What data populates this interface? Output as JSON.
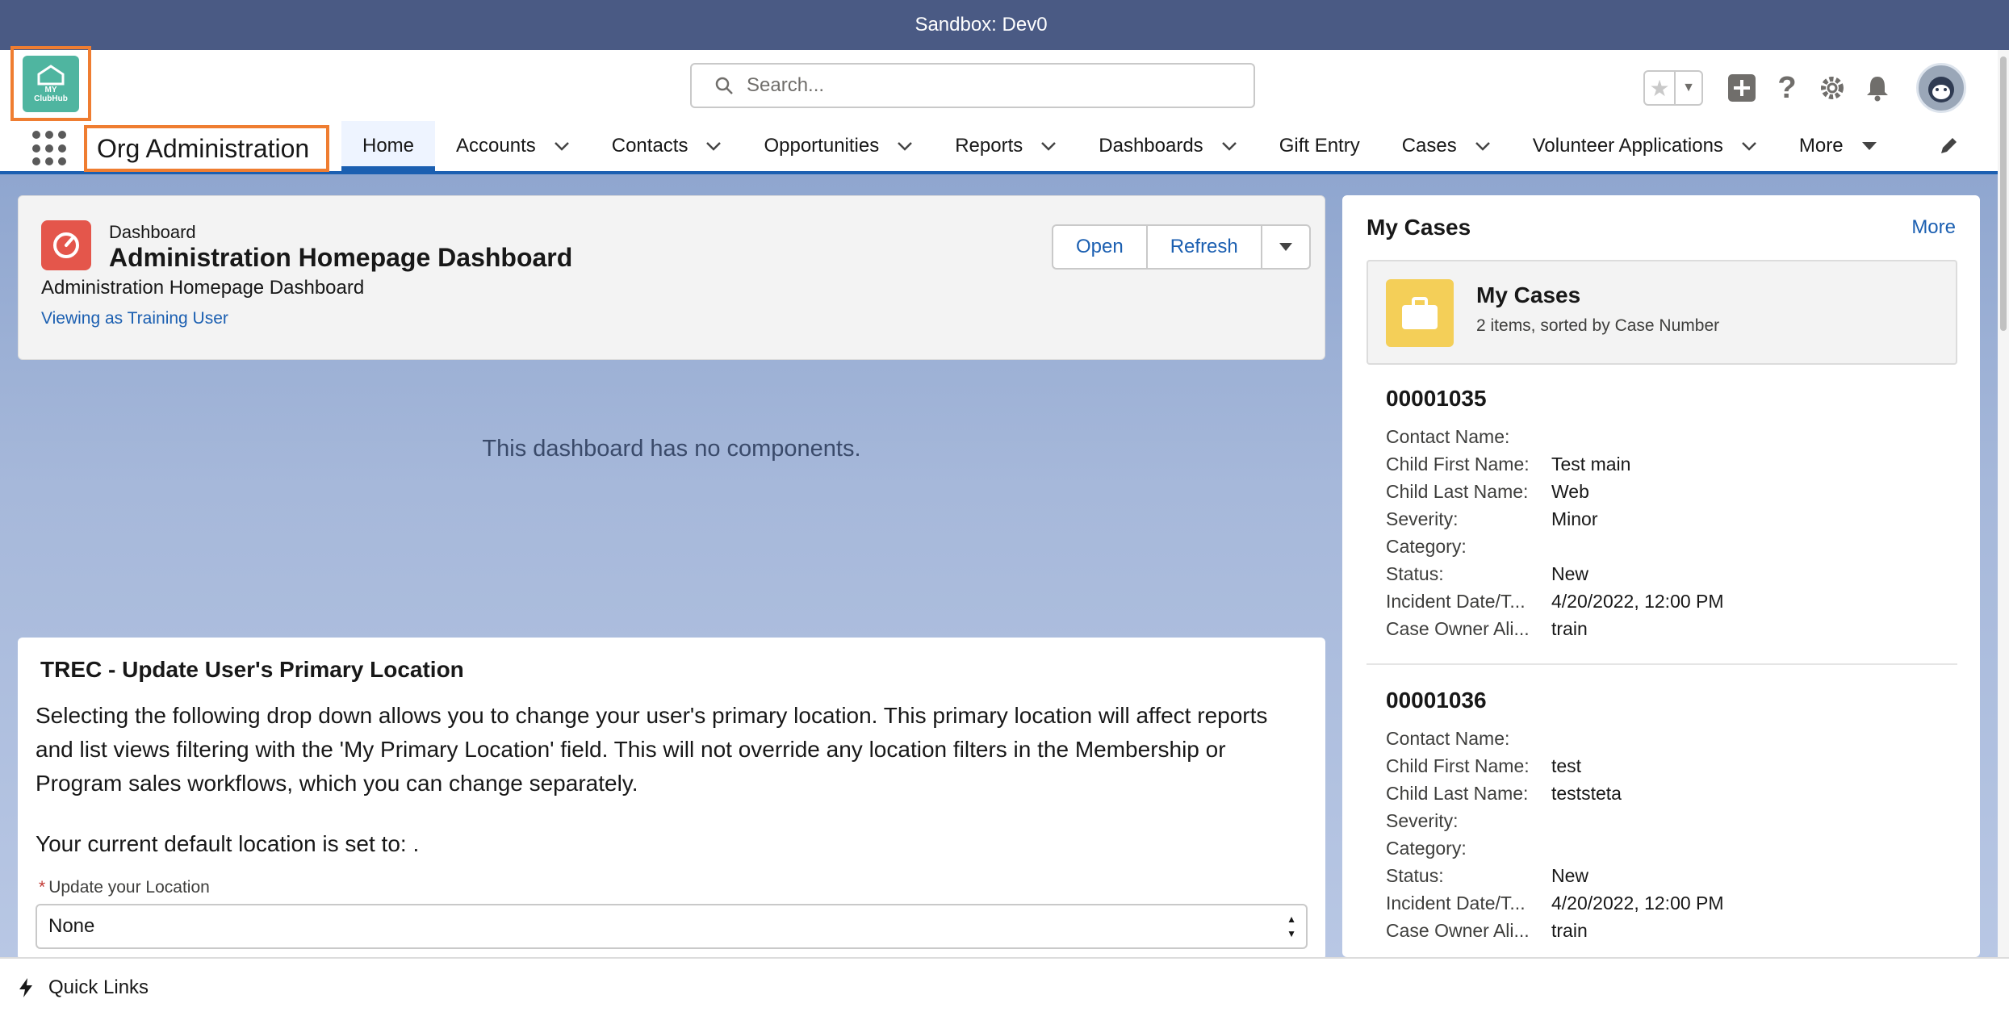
{
  "sandbox": {
    "label": "Sandbox: Dev0"
  },
  "logo": {
    "text_line1": "MY",
    "text_line2": "ClubHub"
  },
  "search": {
    "placeholder": "Search..."
  },
  "app": {
    "name": "Org Administration"
  },
  "nav": {
    "tabs": [
      {
        "label": "Home",
        "active": true,
        "has_menu": false
      },
      {
        "label": "Accounts",
        "has_menu": true
      },
      {
        "label": "Contacts",
        "has_menu": true
      },
      {
        "label": "Opportunities",
        "has_menu": true
      },
      {
        "label": "Reports",
        "has_menu": true
      },
      {
        "label": "Dashboards",
        "has_menu": true
      },
      {
        "label": "Gift Entry",
        "has_menu": false
      },
      {
        "label": "Cases",
        "has_menu": true
      },
      {
        "label": "Volunteer Applications",
        "has_menu": true
      },
      {
        "label": "More",
        "has_menu": true
      }
    ]
  },
  "dashboard": {
    "type_label": "Dashboard",
    "title": "Administration Homepage Dashboard",
    "subtitle": "Administration Homepage Dashboard",
    "viewing_as": "Viewing as Training User",
    "open_label": "Open",
    "refresh_label": "Refresh",
    "empty_message": "This dashboard has no components."
  },
  "trec": {
    "title": "TREC - Update User's Primary Location",
    "description": "Selecting the following drop down allows you to change your user's primary location. This primary location will affect reports and list views filtering with the 'My Primary Location' field. This will not override any location filters in the Membership or Program sales workflows, which you can change separately.",
    "current_location": "Your current default location is set to: .",
    "field_label": "Update your Location",
    "field_required_mark": "*",
    "selected_value": "None"
  },
  "my_cases": {
    "header": "My Cases",
    "more_label": "More",
    "list_title": "My Cases",
    "list_subtitle": "2 items, sorted by Case Number",
    "cases": [
      {
        "number": "00001035",
        "fields": [
          {
            "k": "Contact Name:",
            "v": ""
          },
          {
            "k": "Child First Name:",
            "v": "Test main"
          },
          {
            "k": "Child Last Name:",
            "v": "Web"
          },
          {
            "k": "Severity:",
            "v": "Minor"
          },
          {
            "k": "Category:",
            "v": ""
          },
          {
            "k": "Status:",
            "v": "New"
          },
          {
            "k": "Incident Date/T...",
            "v": "4/20/2022, 12:00 PM"
          },
          {
            "k": "Case Owner Ali...",
            "v": "train"
          }
        ]
      },
      {
        "number": "00001036",
        "fields": [
          {
            "k": "Contact Name:",
            "v": ""
          },
          {
            "k": "Child First Name:",
            "v": "test"
          },
          {
            "k": "Child Last Name:",
            "v": "teststeta"
          },
          {
            "k": "Severity:",
            "v": ""
          },
          {
            "k": "Category:",
            "v": ""
          },
          {
            "k": "Status:",
            "v": "New"
          },
          {
            "k": "Incident Date/T...",
            "v": "4/20/2022, 12:00 PM"
          },
          {
            "k": "Case Owner Ali...",
            "v": "train"
          }
        ]
      }
    ]
  },
  "utility": {
    "quick_links_label": "Quick Links"
  },
  "colors": {
    "brand_blue": "#1b5fb1",
    "sandbox_bar": "#4a5a84",
    "highlight_orange": "#ef7d31",
    "dashboard_icon": "#e4564b",
    "cases_icon": "#f4cf58",
    "logo_teal": "#4fb5a0"
  }
}
